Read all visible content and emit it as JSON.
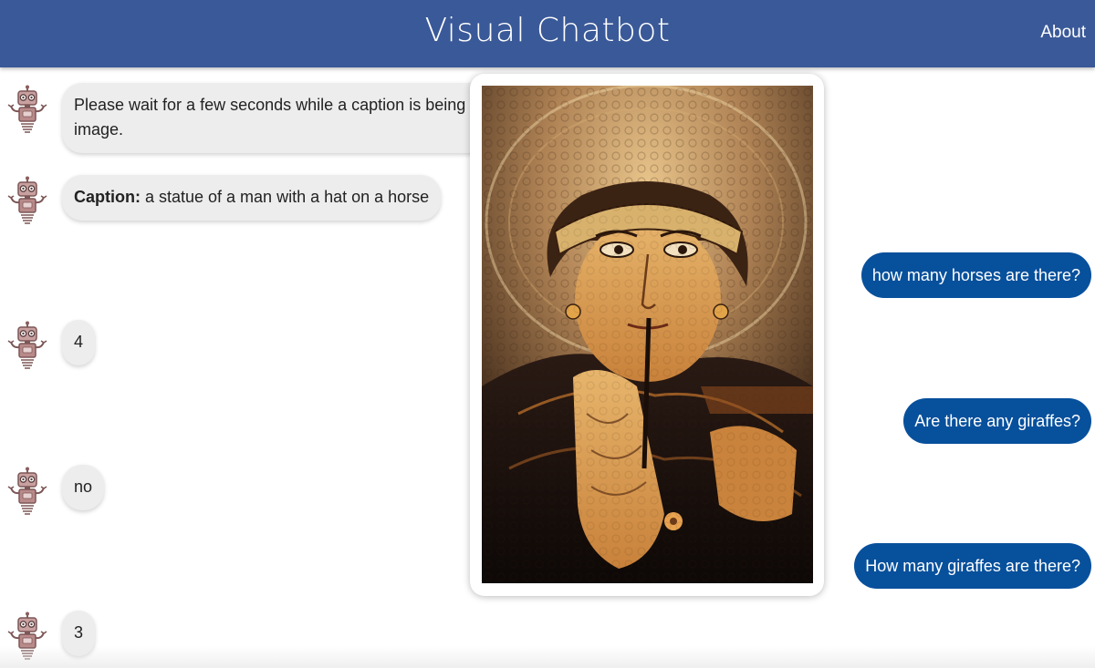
{
  "header": {
    "title": "Visual Chatbot",
    "about_label": "About"
  },
  "messages": {
    "bot_wait_1": "Please wait for a few seconds while a caption is being ge",
    "bot_wait_2": "image.",
    "caption_label": "Caption:",
    "caption_text": " a statue of a man with a hat on a horse",
    "q1": "how many horses are there?",
    "a1": "4",
    "q2": "Are there any giraffes?",
    "a2": "no",
    "q3": "How many giraffes are there?",
    "a3": "3"
  },
  "colors": {
    "header": "#3a5998",
    "user_bubble": "#07509c",
    "bot_bubble": "#ededed"
  },
  "icons": {
    "avatar": "robot-icon"
  }
}
